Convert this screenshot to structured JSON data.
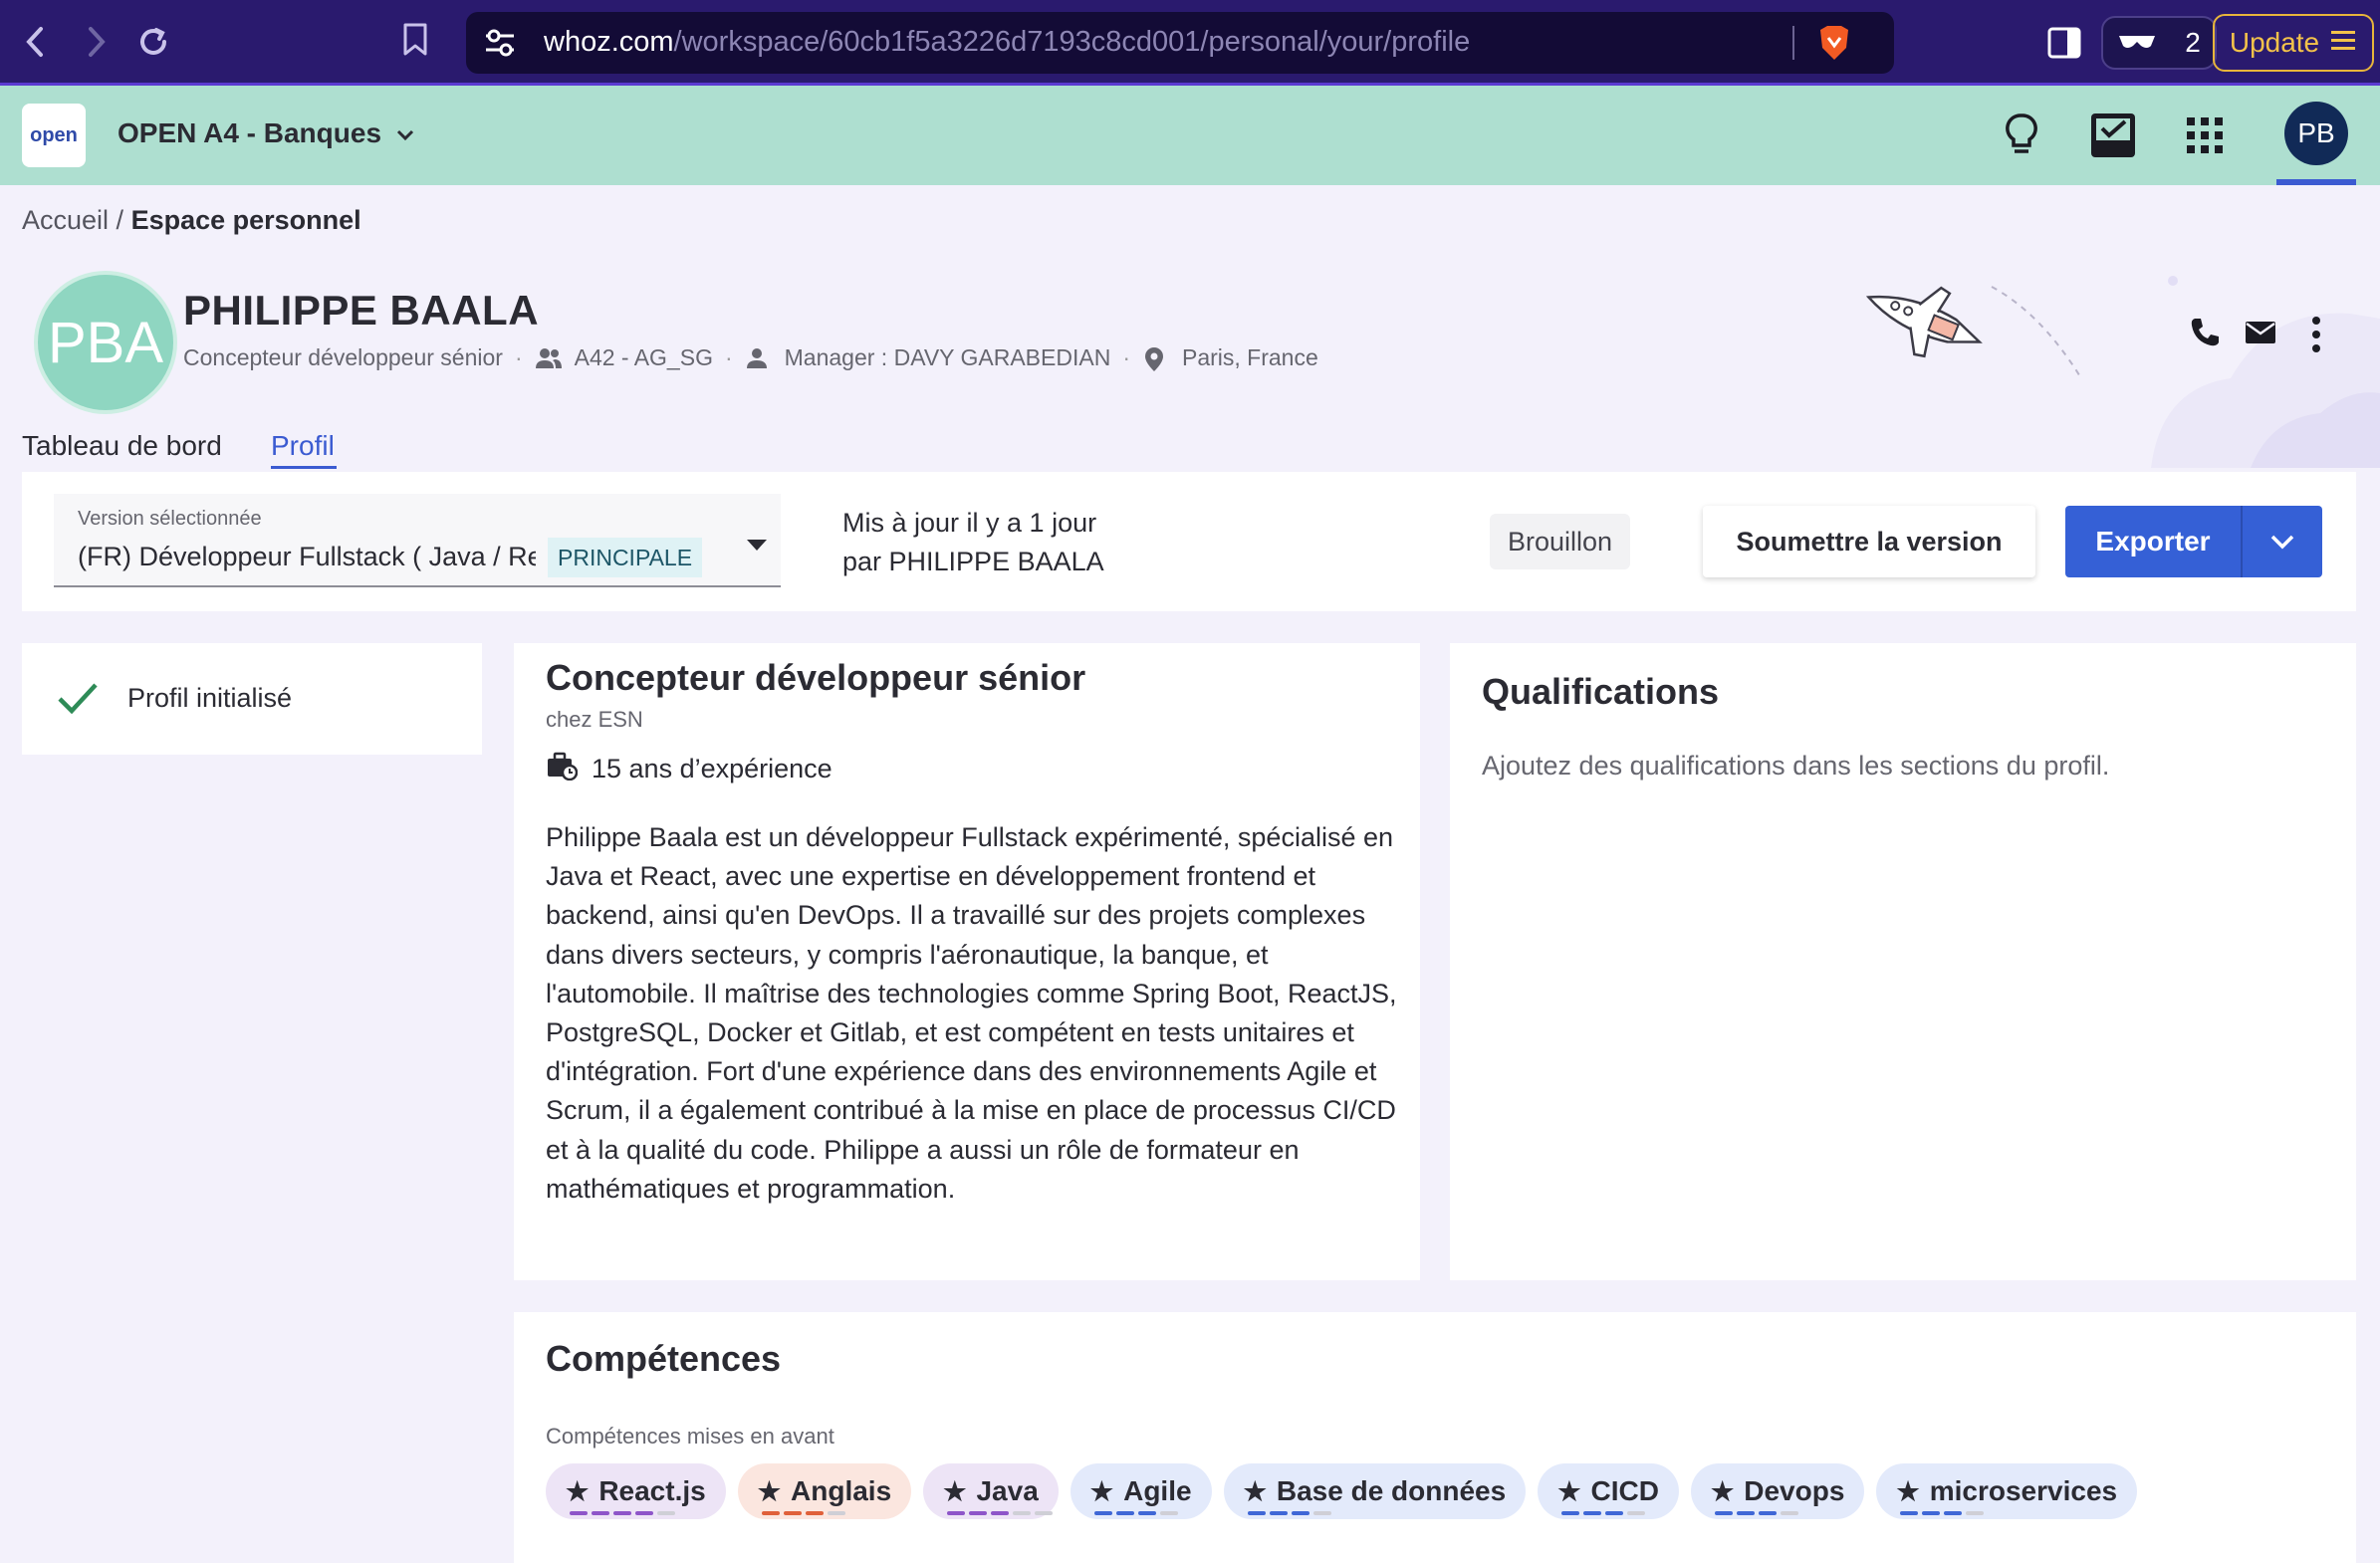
{
  "browser": {
    "url_host": "whoz.com",
    "url_path": "/workspace/60cb1f5a3226d7193c8cd001/personal/your/profile",
    "wallet_count": "2",
    "update_label": "Update"
  },
  "app_header": {
    "logo_text": "open",
    "workspace_name": "OPEN A4 - Banques",
    "user_initials": "PB"
  },
  "breadcrumb": {
    "home": "Accueil",
    "separator": " / ",
    "current": "Espace personnel"
  },
  "profile": {
    "initials": "PBA",
    "name": "PHILIPPE BAALA",
    "job_title": "Concepteur développeur sénior",
    "team": "A42 - AG_SG",
    "manager": "Manager : DAVY GARABEDIAN",
    "location": "Paris, France",
    "separator": "·"
  },
  "tabs": {
    "dashboard": "Tableau de bord",
    "profile": "Profil"
  },
  "version_bar": {
    "select_label": "Version sélectionnée",
    "select_value": "(FR) Développeur Fullstack ( Java / React )",
    "badge": "PRINCIPALE",
    "updated_line1": "Mis à jour il y a 1 jour",
    "updated_line2": "par PHILIPPE BAALA",
    "status": "Brouillon",
    "submit_label": "Soumettre la version",
    "export_label": "Exporter"
  },
  "status_card": {
    "text": "Profil initialisé"
  },
  "job": {
    "title": "Concepteur développeur sénior",
    "company": "chez ESN",
    "experience": "15 ans d’expérience",
    "summary": "Philippe Baala est un développeur Fullstack expérimenté, spécialisé en Java et React, avec une expertise en développement frontend et backend, ainsi qu'en DevOps. Il a travaillé sur des projets complexes dans divers secteurs, y compris l'aéronautique, la banque, et l'automobile. Il maîtrise des technologies comme Spring Boot, ReactJS, PostgreSQL, Docker et Gitlab, et est compétent en tests unitaires et d'intégration. Fort d'une expérience dans des environnements Agile et Scrum, il a également contribué à la mise en place de processus CI/CD et à la qualité du code. Philippe a aussi un rôle de formateur en mathématiques et programmation."
  },
  "qualifications": {
    "title": "Qualifications",
    "empty_text": "Ajoutez des qualifications dans les sections du profil."
  },
  "skills": {
    "title": "Compétences",
    "subtitle": "Compétences mises en avant",
    "chips": [
      {
        "label": "React.js",
        "bg": "#ede4f6",
        "level": 4,
        "max": 5,
        "dash": "#8e55c9"
      },
      {
        "label": "Anglais",
        "bg": "#fbe6df",
        "level": 3,
        "max": 4,
        "dash": "#e0603a"
      },
      {
        "label": "Java",
        "bg": "#ede4f6",
        "level": 3,
        "max": 5,
        "dash": "#8e55c9"
      },
      {
        "label": "Agile",
        "bg": "#e3eafb",
        "level": 3,
        "max": 4,
        "dash": "#3f67d6"
      },
      {
        "label": "Base de données",
        "bg": "#e3eafb",
        "level": 3,
        "max": 4,
        "dash": "#3f67d6"
      },
      {
        "label": "CICD",
        "bg": "#e3eafb",
        "level": 3,
        "max": 4,
        "dash": "#3f67d6"
      },
      {
        "label": "Devops",
        "bg": "#e3eafb",
        "level": 3,
        "max": 4,
        "dash": "#3f67d6"
      },
      {
        "label": "microservices",
        "bg": "#e3eafb",
        "level": 3,
        "max": 4,
        "dash": "#3f67d6"
      }
    ]
  },
  "colors": {
    "header_bg": "#aedfd0",
    "primary": "#3560d6",
    "page_bg": "#f3f1fb"
  }
}
